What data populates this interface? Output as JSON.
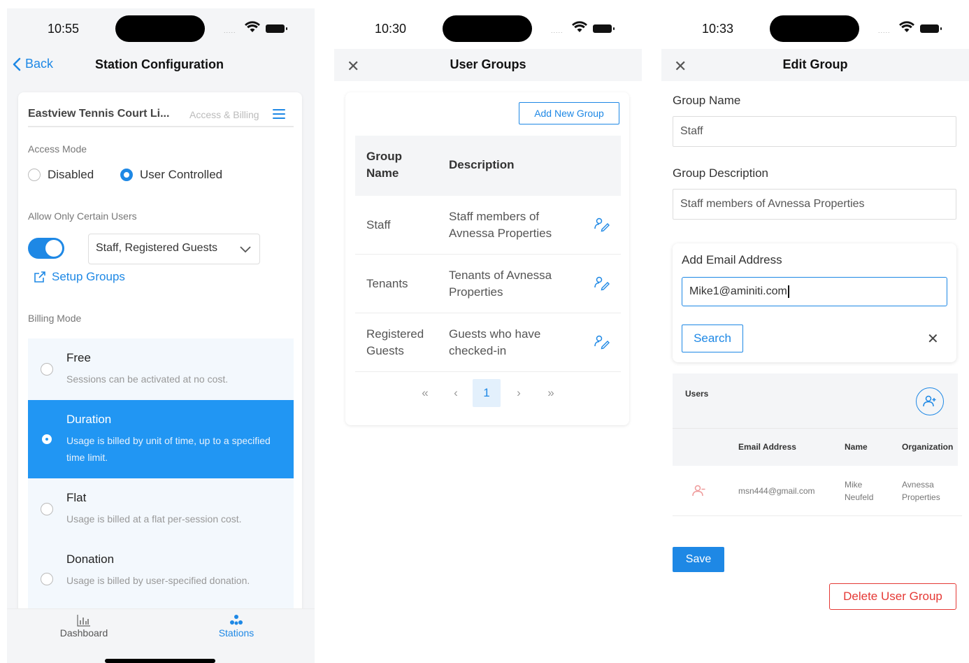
{
  "colors": {
    "accent": "#1e88e5",
    "danger": "#e53935",
    "selected_bg": "#2196f3"
  },
  "screen1": {
    "status_time": "10:55",
    "back_label": "Back",
    "title": "Station Configuration",
    "station_name": "Eastview Tennis Court Li...",
    "header_section": "Access & Billing",
    "access_mode_label": "Access Mode",
    "access_options": [
      {
        "label": "Disabled",
        "selected": false
      },
      {
        "label": "User Controlled",
        "selected": true
      }
    ],
    "allow_users_label": "Allow Only Certain Users",
    "allow_users_enabled": true,
    "groups_select_value": "Staff, Registered Guests",
    "setup_groups_label": "Setup Groups",
    "billing_mode_label": "Billing Mode",
    "billing_options": [
      {
        "title": "Free",
        "desc": "Sessions can be activated at no cost.",
        "selected": false
      },
      {
        "title": "Duration",
        "desc": "Usage is billed by unit of time, up to a specified time limit.",
        "selected": true
      },
      {
        "title": "Flat",
        "desc": "Usage is billed at a flat per-session cost.",
        "selected": false
      },
      {
        "title": "Donation",
        "desc": "Usage is billed by user-specified donation.",
        "selected": false
      }
    ],
    "tabs": [
      {
        "label": "Dashboard",
        "icon": "bar-chart-icon",
        "active": false
      },
      {
        "label": "Stations",
        "icon": "stations-icon",
        "active": true
      }
    ]
  },
  "screen2": {
    "status_time": "10:30",
    "title": "User Groups",
    "add_button": "Add New Group",
    "columns": [
      "Group Name",
      "Description"
    ],
    "rows": [
      {
        "name": "Staff",
        "description": "Staff members of Avnessa Properties"
      },
      {
        "name": "Tenants",
        "description": "Tenants of Avnessa Properties"
      },
      {
        "name": "Registered Guests",
        "description": "Guests who have checked-in"
      }
    ],
    "pagination": {
      "first": "«",
      "prev": "‹",
      "current": "1",
      "next": "›",
      "last": "»"
    }
  },
  "screen3": {
    "status_time": "10:33",
    "title": "Edit Group",
    "group_name_label": "Group Name",
    "group_name_value": "Staff",
    "group_desc_label": "Group Description",
    "group_desc_value": "Staff members of Avnessa Properties",
    "add_email_label": "Add Email Address",
    "email_value": "Mike1@aminiti.com",
    "search_button": "Search",
    "users_title": "Users",
    "user_columns": [
      "Email Address",
      "Name",
      "Organization"
    ],
    "users": [
      {
        "email": "msn444@gmail.com",
        "name": "Mike Neufeld",
        "organization": "Avnessa Properties"
      }
    ],
    "save_button": "Save",
    "delete_button": "Delete User Group"
  }
}
